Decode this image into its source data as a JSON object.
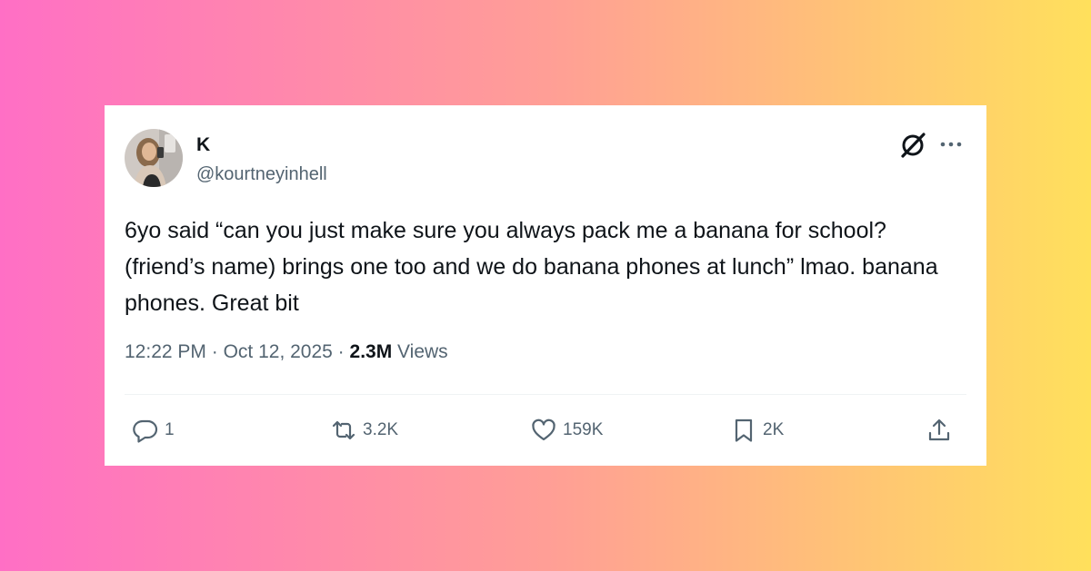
{
  "colors": {
    "background_gradient": [
      "#ff6fc5",
      "#ffe05c"
    ],
    "card_background": "#ffffff",
    "text_primary": "#0f1419",
    "text_secondary": "#536471"
  },
  "tweet": {
    "author": {
      "display_name": "K",
      "handle": "@kourtneyinhell",
      "avatar_icon": "profile-photo"
    },
    "header_icons": [
      "grok-logo-icon",
      "more-options-icon"
    ],
    "text": "6yo said “can you just make sure you always pack me a banana for school? (friend’s name) brings one too and we do banana phones at lunch” lmao. banana phones. Great bit",
    "meta": {
      "time": "12:22 PM",
      "separator": "·",
      "date": "Oct 12, 2025",
      "views_count": "2.3M",
      "views_label": "Views"
    },
    "actions": {
      "reply": {
        "icon": "reply-icon",
        "count": "1"
      },
      "repost": {
        "icon": "repost-icon",
        "count": "3.2K"
      },
      "like": {
        "icon": "heart-icon",
        "count": "159K"
      },
      "bookmark": {
        "icon": "bookmark-icon",
        "count": "2K"
      },
      "share": {
        "icon": "share-icon"
      }
    }
  }
}
